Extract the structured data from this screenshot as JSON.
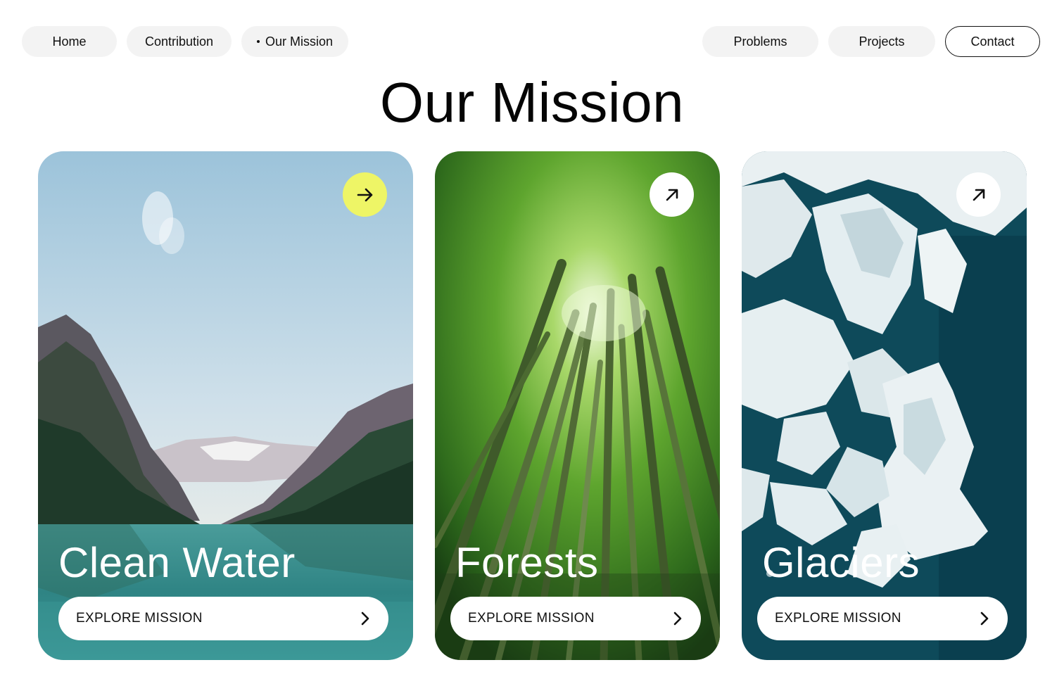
{
  "nav": {
    "left": [
      "Home",
      "Contribution",
      "Our Mission"
    ],
    "right": [
      "Problems",
      "Projects",
      "Contact"
    ],
    "active": "Our Mission"
  },
  "page_title": "Our Mission",
  "cards": [
    {
      "title": "Clean Water",
      "cta": "EXPLORE MISSION",
      "corner_icon": "arrow-right-icon",
      "corner_color": "#eef566"
    },
    {
      "title": "Forests",
      "cta": "EXPLORE MISSION",
      "corner_icon": "arrow-up-right-icon",
      "corner_color": "#ffffff"
    },
    {
      "title": "Glaciers",
      "cta": "EXPLORE MISSION",
      "corner_icon": "arrow-up-right-icon",
      "corner_color": "#ffffff"
    }
  ],
  "colors": {
    "accent": "#eef566",
    "nav_bg": "#f3f3f3",
    "text": "#0a0a0a"
  }
}
